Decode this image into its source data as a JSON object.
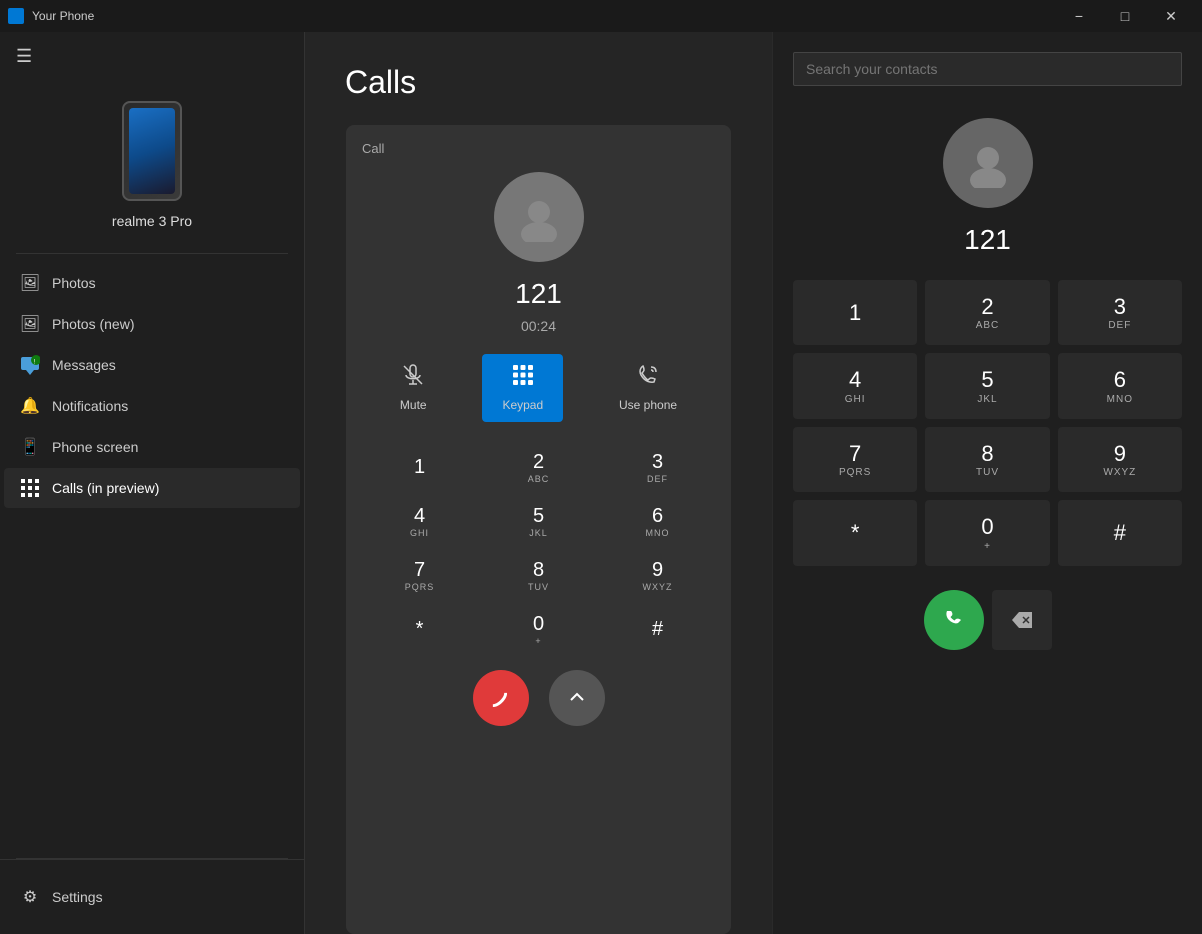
{
  "titlebar": {
    "app_name": "Your Phone",
    "minimize_label": "−",
    "maximize_label": "□",
    "close_label": "✕"
  },
  "sidebar": {
    "hamburger": "☰",
    "device_name": "realme 3 Pro",
    "nav_items": [
      {
        "id": "photos",
        "label": "Photos",
        "icon": "🖼"
      },
      {
        "id": "photos-new",
        "label": "Photos (new)",
        "icon": "🖼"
      },
      {
        "id": "messages",
        "label": "Messages",
        "icon": "💬"
      },
      {
        "id": "notifications",
        "label": "Notifications",
        "icon": "🔔"
      },
      {
        "id": "phone-screen",
        "label": "Phone screen",
        "icon": "📱"
      },
      {
        "id": "calls",
        "label": "Calls (in preview)",
        "icon": "⠿",
        "active": true
      }
    ],
    "settings_label": "Settings"
  },
  "main": {
    "header": "Calls",
    "card_label": "Call",
    "call_number": "121",
    "call_timer": "00:24",
    "mute_label": "Mute",
    "keypad_label": "Keypad",
    "use_phone_label": "Use phone",
    "keys": [
      {
        "main": "1",
        "sub": ""
      },
      {
        "main": "2",
        "sub": "ABC"
      },
      {
        "main": "3",
        "sub": "DEF"
      },
      {
        "main": "4",
        "sub": "GHI"
      },
      {
        "main": "5",
        "sub": "JKL"
      },
      {
        "main": "6",
        "sub": "MNO"
      },
      {
        "main": "7",
        "sub": "PQRS"
      },
      {
        "main": "8",
        "sub": "TUV"
      },
      {
        "main": "9",
        "sub": "WXYZ"
      },
      {
        "main": "*",
        "sub": ""
      },
      {
        "main": "0",
        "sub": "+"
      },
      {
        "main": "#",
        "sub": ""
      }
    ]
  },
  "right_panel": {
    "search_placeholder": "Search your contacts",
    "call_number": "121",
    "keys": [
      {
        "main": "1",
        "sub": ""
      },
      {
        "main": "2",
        "sub": "ABC"
      },
      {
        "main": "3",
        "sub": "DEF"
      },
      {
        "main": "4",
        "sub": "GHI"
      },
      {
        "main": "5",
        "sub": "JKL"
      },
      {
        "main": "6",
        "sub": "MNO"
      },
      {
        "main": "7",
        "sub": "PQRS"
      },
      {
        "main": "8",
        "sub": "TUV"
      },
      {
        "main": "9",
        "sub": "WXYZ"
      },
      {
        "main": "*",
        "sub": ""
      },
      {
        "main": "0",
        "sub": "+"
      },
      {
        "main": "#",
        "sub": ""
      }
    ]
  }
}
